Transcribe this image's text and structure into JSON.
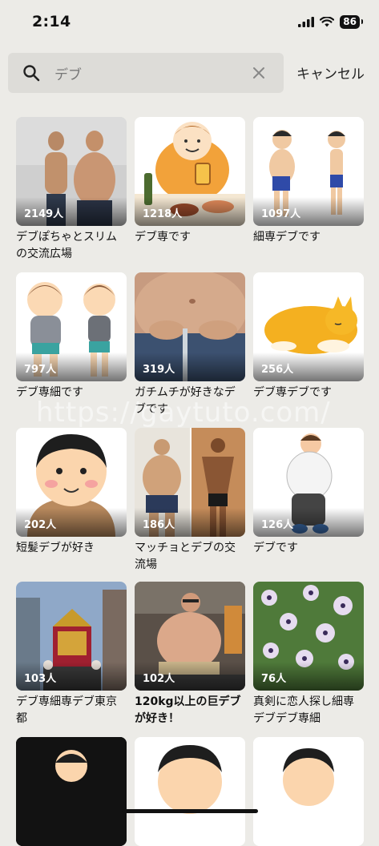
{
  "status": {
    "time": "2:14",
    "battery": "86"
  },
  "search": {
    "query": "デブ",
    "cancel_label": "キャンセル"
  },
  "watermark": "https://gaytuto.com/",
  "groups": [
    {
      "count": "2149人",
      "title": "デブぽちゃとスリムの交流広場"
    },
    {
      "count": "1218人",
      "title": "デブ専です"
    },
    {
      "count": "1097人",
      "title": "細専デブです"
    },
    {
      "count": "797人",
      "title": "デブ専細です"
    },
    {
      "count": "319人",
      "title": "ガチムチが好きなデブです"
    },
    {
      "count": "256人",
      "title": "デブ専デブです"
    },
    {
      "count": "202人",
      "title": "短髪デブが好き"
    },
    {
      "count": "186人",
      "title": "マッチョとデブの交流場"
    },
    {
      "count": "126人",
      "title": "デブです"
    },
    {
      "count": "103人",
      "title": "デブ専細専デブ東京都"
    },
    {
      "count": "102人",
      "title": "120kg以上の巨デブが好き！"
    },
    {
      "count": "76人",
      "title": "真剣に恋人探し細専デブデブ専細"
    },
    {
      "count": "",
      "title": ""
    },
    {
      "count": "",
      "title": ""
    },
    {
      "count": "",
      "title": ""
    }
  ]
}
